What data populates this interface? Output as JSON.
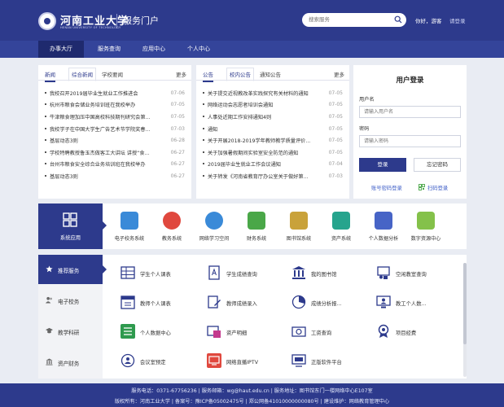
{
  "header": {
    "school_name": "河南工业大学",
    "school_name_en": "HENAN UNIVERSITY OF TECHNOLOGY",
    "portal_title": "服务门户",
    "search_placeholder": "搜索服务",
    "greeting": "你好，游客",
    "login_link": "请登录"
  },
  "nav": {
    "items": [
      "办事大厅",
      "服务查询",
      "应用中心",
      "个人中心"
    ],
    "active": "办事大厅"
  },
  "news_panel": {
    "tabs": [
      "新闻",
      "综合新闻",
      "学校要闻"
    ],
    "active_tab": "综合新闻",
    "more": "更多",
    "items": [
      {
        "title": "我校召开2019届毕业生就业工作推进会",
        "date": "07-06"
      },
      {
        "title": "杭州市粮食会储业务培训班在我校举办",
        "date": "07-05"
      },
      {
        "title": "牛津粮食理加压中国高校科技期刊研究会第...",
        "date": "07-05"
      },
      {
        "title": "我校学子在中国大学生广告艺术节学院奖春...",
        "date": "07-03"
      },
      {
        "title": "基层动态3则",
        "date": "06-28"
      },
      {
        "title": "学校特聘教授鲁玉杰做客工大讲坛 讲授“食...",
        "date": "06-27"
      },
      {
        "title": "台州市粮食安全综合业务培训班在我校举办",
        "date": "06-27"
      },
      {
        "title": "基层动态3则",
        "date": "06-27"
      }
    ]
  },
  "notice_panel": {
    "tabs": [
      "公告",
      "校内公告",
      "通知公告"
    ],
    "active_tab": "校内公告",
    "more": "更多",
    "items": [
      {
        "title": "关于提交近视教改革实践探究有关材料的通知",
        "date": "07-05"
      },
      {
        "title": "网络运动会志愿者培训会通知",
        "date": "07-05"
      },
      {
        "title": "人事处近期工作安排通知4则",
        "date": "07-05"
      },
      {
        "title": "通知",
        "date": "07-05"
      },
      {
        "title": "关于开展2018-2019学年教师教学质量评价...",
        "date": "07-05"
      },
      {
        "title": "关于加强暑假期间实验室安全防范的通知",
        "date": "07-05"
      },
      {
        "title": "2019届毕业生就业工作会议通知",
        "date": "07-04"
      },
      {
        "title": "关于转发《河南省教育厅办公室关于做好第...",
        "date": "07-03"
      }
    ]
  },
  "login": {
    "title": "用户登录",
    "username_label": "用户名",
    "username_placeholder": "请输入用户名",
    "password_label": "密码",
    "password_placeholder": "请输入密码",
    "login_button": "登录",
    "forgot_button": "忘记密码",
    "activate_link": "账号密码登录",
    "scan_link": "扫码登录"
  },
  "systems": {
    "title": "系统应用",
    "apps": [
      {
        "label": "电子校务系统",
        "icon": "hand-icon",
        "color": "#3a8ad8"
      },
      {
        "label": "教务系统",
        "icon": "gear-icon",
        "color": "#e0483e"
      },
      {
        "label": "网络学习空间",
        "icon": "globe-icon",
        "color": "#3a8ad8"
      },
      {
        "label": "财务系统",
        "icon": "finance-icon",
        "color": "#4aa748"
      },
      {
        "label": "图书馆系统",
        "icon": "books-icon",
        "color": "#c9a23a"
      },
      {
        "label": "资产系统",
        "icon": "asset-icon",
        "color": "#26a48d"
      },
      {
        "label": "个人数据分析",
        "icon": "person-icon",
        "color": "#4764c6"
      },
      {
        "label": "数字资源中心",
        "icon": "chart-icon",
        "color": "#84c14a"
      }
    ]
  },
  "services": {
    "sidebar": [
      {
        "label": "推荐服务",
        "icon": "star-icon"
      },
      {
        "label": "电子校务",
        "icon": "people-icon"
      },
      {
        "label": "教学科研",
        "icon": "mortarboard-icon"
      },
      {
        "label": "资产财务",
        "icon": "building-icon"
      }
    ],
    "active": "推荐服务",
    "items": [
      {
        "label": "学生个人课表",
        "icon": "table-icon"
      },
      {
        "label": "学生成绩查询",
        "icon": "document-a-icon"
      },
      {
        "label": "我的图书馆",
        "icon": "library-icon"
      },
      {
        "label": "空闲教室查询",
        "icon": "classroom-icon"
      },
      {
        "label": "教师个人课表",
        "icon": "schedule-icon"
      },
      {
        "label": "教师成绩录入",
        "icon": "edit-icon"
      },
      {
        "label": "成绩分析报...",
        "icon": "analysis-icon"
      },
      {
        "label": "教工个人数...",
        "icon": "staff-data-icon"
      },
      {
        "label": "个人数据中心",
        "icon": "data-center-icon"
      },
      {
        "label": "资产明细",
        "icon": "asset-detail-icon"
      },
      {
        "label": "工资查询",
        "icon": "salary-icon"
      },
      {
        "label": "项目经费",
        "icon": "project-funds-icon"
      },
      {
        "label": "会议室预定",
        "icon": "meeting-icon"
      },
      {
        "label": "网络直播IPTV",
        "icon": "iptv-icon"
      },
      {
        "label": "正版软件平台",
        "icon": "software-icon"
      }
    ]
  },
  "footer": {
    "line1": "服务电话：0371-67756236 | 服务邮箱：wg@haut.edu.cn | 服务地址：图书馆东门一楼网络中心E107室",
    "line2": "版权所有：河南工业大学 | 备案号：豫ICP备05002475号 | 郑公网备41010000000080号 | 建设维护：网络教育管理中心"
  }
}
